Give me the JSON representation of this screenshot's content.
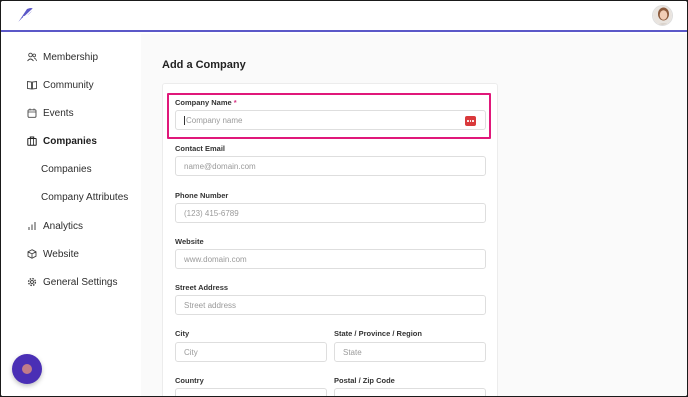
{
  "colors": {
    "accent": "#5b58c8",
    "highlight": "#e0187a",
    "required": "#d63384",
    "fab": "#4a2fb5"
  },
  "sidebar": {
    "items": [
      {
        "label": "Membership",
        "icon": "users-icon"
      },
      {
        "label": "Community",
        "icon": "book-icon"
      },
      {
        "label": "Events",
        "icon": "calendar-icon"
      },
      {
        "label": "Companies",
        "icon": "building-icon"
      },
      {
        "label": "Companies"
      },
      {
        "label": "Company Attributes"
      },
      {
        "label": "Analytics",
        "icon": "bar-chart-icon"
      },
      {
        "label": "Website",
        "icon": "cube-icon"
      },
      {
        "label": "General Settings",
        "icon": "gear-icon"
      }
    ]
  },
  "main": {
    "title": "Add a Company",
    "form": {
      "company_name": {
        "label": "Company Name",
        "required": "*",
        "placeholder": "Company name"
      },
      "contact_email": {
        "label": "Contact Email",
        "placeholder": "name@domain.com"
      },
      "phone": {
        "label": "Phone Number",
        "placeholder": "(123) 415-6789"
      },
      "website": {
        "label": "Website",
        "placeholder": "www.domain.com"
      },
      "street": {
        "label": "Street Address",
        "placeholder": "Street address"
      },
      "city": {
        "label": "City",
        "placeholder": "City"
      },
      "state": {
        "label": "State / Province / Region",
        "placeholder": "State"
      },
      "country": {
        "label": "Country"
      },
      "postal": {
        "label": "Postal / Zip Code"
      }
    }
  }
}
